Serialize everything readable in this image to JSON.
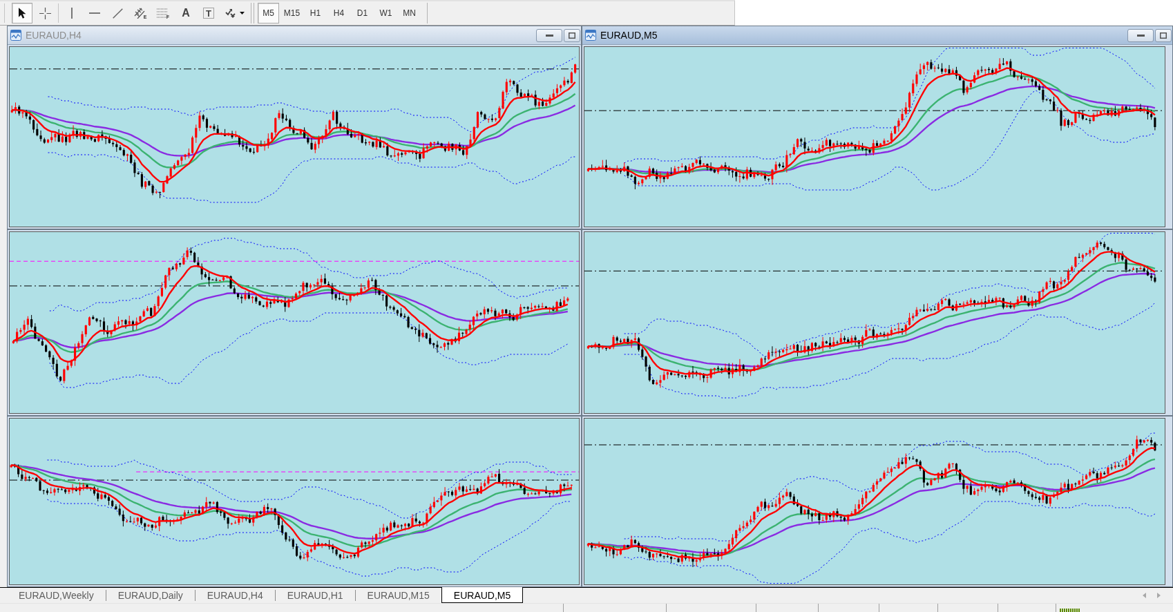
{
  "toolbar": {
    "tools": [
      {
        "kind": "cursor",
        "selected": true
      },
      {
        "kind": "crosshair",
        "selected": false
      },
      {
        "kind": "vertical-line",
        "selected": false
      },
      {
        "kind": "horizontal-line",
        "selected": false
      },
      {
        "kind": "trend-line",
        "selected": false
      },
      {
        "kind": "channel",
        "badge": "E",
        "selected": false
      },
      {
        "kind": "fibonacci",
        "badge": "F",
        "selected": false
      },
      {
        "kind": "text",
        "label": "A",
        "selected": false
      },
      {
        "kind": "text-label",
        "label": "T",
        "selected": false
      },
      {
        "kind": "shapes",
        "selected": false
      }
    ],
    "timeframes": [
      {
        "label": "M5",
        "selected": true
      },
      {
        "label": "M15",
        "selected": false
      },
      {
        "label": "H1",
        "selected": false
      },
      {
        "label": "H4",
        "selected": false
      },
      {
        "label": "D1",
        "selected": false
      },
      {
        "label": "W1",
        "selected": false
      },
      {
        "label": "MN",
        "selected": false
      }
    ]
  },
  "windows": [
    {
      "title": "EURAUD,H4",
      "active": false
    },
    {
      "title": "EURAUD,M5",
      "active": true
    }
  ],
  "tabs": [
    {
      "label": "EURAUD,Weekly",
      "selected": false
    },
    {
      "label": "EURAUD,Daily",
      "selected": false
    },
    {
      "label": "EURAUD,H4",
      "selected": false
    },
    {
      "label": "EURAUD,H1",
      "selected": false
    },
    {
      "label": "EURAUD,M15",
      "selected": false
    },
    {
      "label": "EURAUD,M5",
      "selected": true
    }
  ]
}
